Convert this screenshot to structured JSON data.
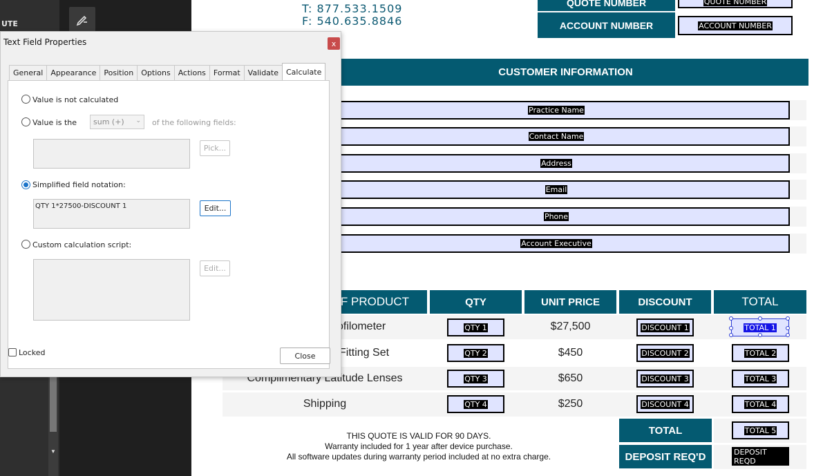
{
  "app": {
    "side_label": "UTE"
  },
  "document": {
    "phone": "T: 877.533.1509",
    "fax": "F: 540.635.8846",
    "quote_number_label": "QUOTE NUMBER",
    "quote_number_field": "QUOTE NUMBER",
    "account_number_label": "ACCOUNT NUMBER",
    "account_number_field": "ACCOUNT NUMBER",
    "customer_info_header": "CUSTOMER INFORMATION",
    "customer_fields": [
      "Practice Name",
      "Contact Name",
      "Address",
      "Email",
      "Phone",
      "Account Executive"
    ],
    "table_headers": {
      "product": "F PRODUCT",
      "qty": "QTY",
      "unit_price": "UNIT PRICE",
      "discount": "DISCOUNT",
      "total": "TOTAL"
    },
    "rows": [
      {
        "product": "Profilometer",
        "qty": "QTY 1",
        "price": "$27,500",
        "discount": "DISCOUNT 1",
        "total": "TOTAL 1"
      },
      {
        "product": "Fitting Set",
        "qty": "QTY 2",
        "price": "$450",
        "discount": "DISCOUNT 2",
        "total": "TOTAL 2"
      },
      {
        "product": "Complimentary Latitude Lenses",
        "qty": "QTY 3",
        "price": "$650",
        "discount": "DISCOUNT 3",
        "total": "TOTAL 3"
      },
      {
        "product": "Shipping",
        "qty": "QTY 4",
        "price": "$250",
        "discount": "DISCOUNT 4",
        "total": "TOTAL 4"
      }
    ],
    "total_label": "TOTAL",
    "total_field": "TOTAL 5",
    "deposit_label": "DEPOSIT REQ'D",
    "deposit_field": "DEPOSIT REQD",
    "notes": [
      "THIS QUOTE IS VALID FOR 90 DAYS.",
      "Warranty included for 1 year after device purchase.",
      "All software updates during warranty period included at no extra charge."
    ]
  },
  "dialog": {
    "title": "Text Field Properties",
    "close_glyph": "x",
    "tabs": [
      "General",
      "Appearance",
      "Position",
      "Options",
      "Actions",
      "Format",
      "Validate",
      "Calculate"
    ],
    "active_tab": "Calculate",
    "opt_not_calculated": "Value is not calculated",
    "opt_value_is": "Value is the",
    "operation_select": "sum (+)",
    "of_following": "of the following fields:",
    "pick_button": "Pick...",
    "opt_simplified": "Simplified field notation:",
    "simplified_value": "QTY 1*27500-DISCOUNT 1",
    "edit_button": "Edit...",
    "opt_custom": "Custom calculation script:",
    "edit_button_2": "Edit...",
    "locked_label": "Locked",
    "close_button": "Close"
  }
}
